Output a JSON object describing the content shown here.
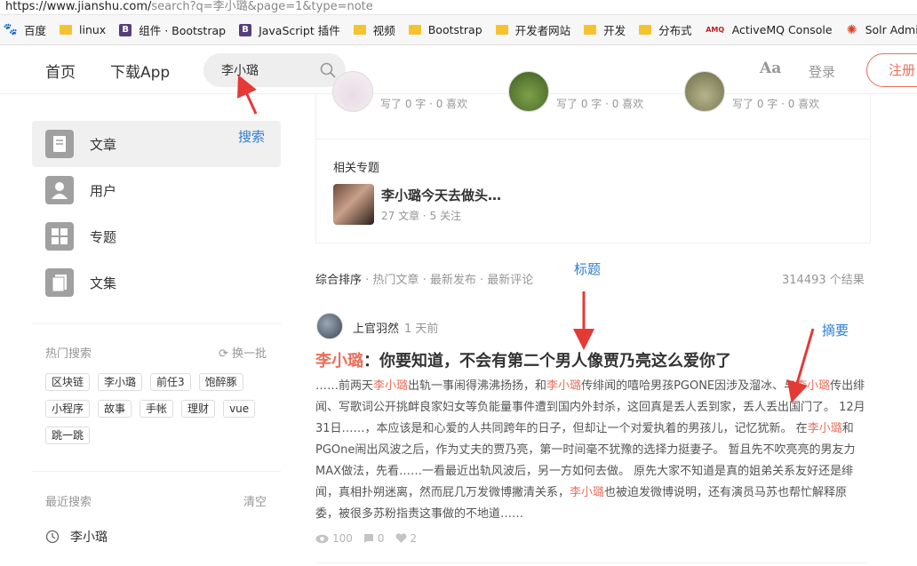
{
  "browser": {
    "url_host": "https://www.jianshu.com/",
    "url_rest": "search?q=李小璐&page=1&type=note",
    "bookmarks": [
      {
        "label": "百度",
        "icon": "baidu-icon"
      },
      {
        "label": "linux",
        "icon": "folder-icon"
      },
      {
        "label": "组件 · Bootstrap",
        "icon": "bootstrap-icon"
      },
      {
        "label": "JavaScript 插件",
        "icon": "bootstrap-icon"
      },
      {
        "label": "视频",
        "icon": "folder-icon"
      },
      {
        "label": "Bootstrap",
        "icon": "folder-icon"
      },
      {
        "label": "开发者网站",
        "icon": "folder-icon"
      },
      {
        "label": "开发",
        "icon": "folder-icon"
      },
      {
        "label": "分布式",
        "icon": "folder-icon"
      },
      {
        "label": "ActiveMQ Console",
        "icon": "activemq-icon"
      },
      {
        "label": "Solr Admin",
        "icon": "solr-icon"
      }
    ]
  },
  "nav": {
    "home": "首页",
    "download": "下载App",
    "search_value": "李小璐",
    "font_toggle": "Aa",
    "login": "登录",
    "register": "注册"
  },
  "sidebar": {
    "items": [
      {
        "label": "文章",
        "icon": "article-icon",
        "active": true
      },
      {
        "label": "用户",
        "icon": "user-icon",
        "active": false
      },
      {
        "label": "专题",
        "icon": "collection-icon",
        "active": false
      },
      {
        "label": "文集",
        "icon": "notebook-icon",
        "active": false
      }
    ],
    "hot_title": "热门搜索",
    "hot_refresh": "换一批",
    "hot_tags": [
      "区块链",
      "李小璐",
      "前任3",
      "饱醉豚",
      "小程序",
      "故事",
      "手帐",
      "理财",
      "vue",
      "跳一跳"
    ],
    "recent_title": "最近搜索",
    "recent_clear": "清空",
    "recent_items": [
      "李小璐"
    ]
  },
  "users_strip": {
    "meta": [
      "写了 0 字 · 0 喜欢",
      "写了 0 字 · 0 喜欢",
      "写了 0 字 · 0 喜欢"
    ]
  },
  "related": {
    "title": "相关专题",
    "collection_name": "李小璐今天去做头…",
    "collection_meta": "27 文章 · 5 关注"
  },
  "sort": {
    "options": [
      "综合排序",
      "热门文章",
      "最新发布",
      "最新评论"
    ],
    "result_count": "314493 个结果"
  },
  "article": {
    "author": "上官羽然",
    "time": "1 天前",
    "title_highlight": "李小璐",
    "title_rest": "：你要知道，不会有第二个男人像贾乃亮这么爱你了",
    "abstract_parts": [
      {
        "text": "……前两天",
        "hl": false
      },
      {
        "text": "李小璐",
        "hl": true
      },
      {
        "text": "出轨一事闹得沸沸扬扬，和",
        "hl": false
      },
      {
        "text": "李小璐",
        "hl": true
      },
      {
        "text": "传绯闻的嘻哈男孩PGONE因涉及溜冰、与",
        "hl": false
      },
      {
        "text": "李小璐",
        "hl": true
      },
      {
        "text": "传出绯闻、写歌词公开挑衅良家妇女等负能量事件遭到国内外封杀，这回真是丢人丢到家，丢人丢出国门了。 12月31日……，本应该是和心爱的人共同跨年的日子，但却让一个对爱执着的男孩儿，记忆犹新。 在",
        "hl": false
      },
      {
        "text": "李小璐",
        "hl": true
      },
      {
        "text": "和PGOne闹出风波之后，作为丈夫的贾乃亮，第一时间毫不犹豫的选择力挺妻子。 暂且先不吹亮亮的男友力MAX做法，先看……一看最近出轨风波后，另一方如何去做。 原先大家不知道是真的姐弟关系友好还是绯闻，真相扑朔迷离，然而屁几万发微博撇清关系，",
        "hl": false
      },
      {
        "text": "李小璐",
        "hl": true
      },
      {
        "text": "也被迫发微博说明，还有演员马苏也帮忙解释原委，被很多苏粉指责这事做的不地道……",
        "hl": false
      }
    ],
    "views": "100",
    "comments": "0",
    "likes": "2"
  },
  "annotations": {
    "search": "搜索",
    "title": "标题",
    "abstract": "摘要"
  }
}
